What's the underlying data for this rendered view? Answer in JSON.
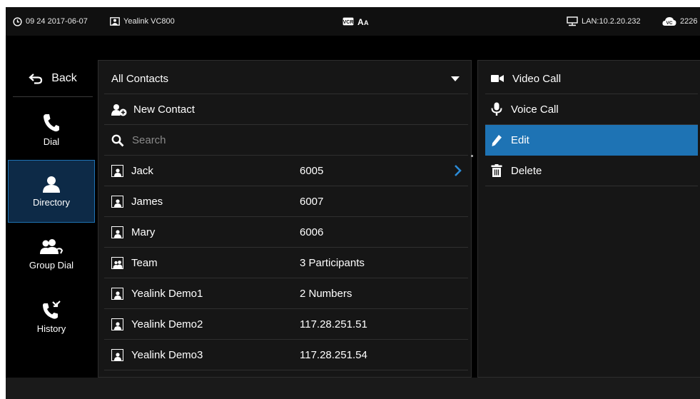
{
  "status_bar": {
    "datetime": "09 24 2017-06-07",
    "device_name": "Yealink VC800",
    "lan_ip": "LAN:10.2.20.232",
    "extension": "2226"
  },
  "nav": {
    "back_label": "Back",
    "items": [
      {
        "label": "Dial"
      },
      {
        "label": "Directory"
      },
      {
        "label": "Group Dial"
      },
      {
        "label": "History"
      }
    ]
  },
  "contacts": {
    "filter_label": "All Contacts",
    "new_contact_label": "New Contact",
    "search_placeholder": "Search",
    "rows": [
      {
        "name": "Jack",
        "detail": "6005"
      },
      {
        "name": "James",
        "detail": "6007"
      },
      {
        "name": "Mary",
        "detail": "6006"
      },
      {
        "name": "Team",
        "detail": "3 Participants"
      },
      {
        "name": "Yealink Demo1",
        "detail": "2 Numbers"
      },
      {
        "name": "Yealink Demo2",
        "detail": "117.28.251.51"
      },
      {
        "name": "Yealink Demo3",
        "detail": "117.28.251.54"
      }
    ]
  },
  "actions": {
    "video_call": "Video Call",
    "voice_call": "Voice Call",
    "edit": "Edit",
    "delete": "Delete"
  },
  "colors": {
    "accent": "#1e73b4",
    "nav_active_bg": "#0d2a47",
    "panel_bg": "#161616"
  }
}
